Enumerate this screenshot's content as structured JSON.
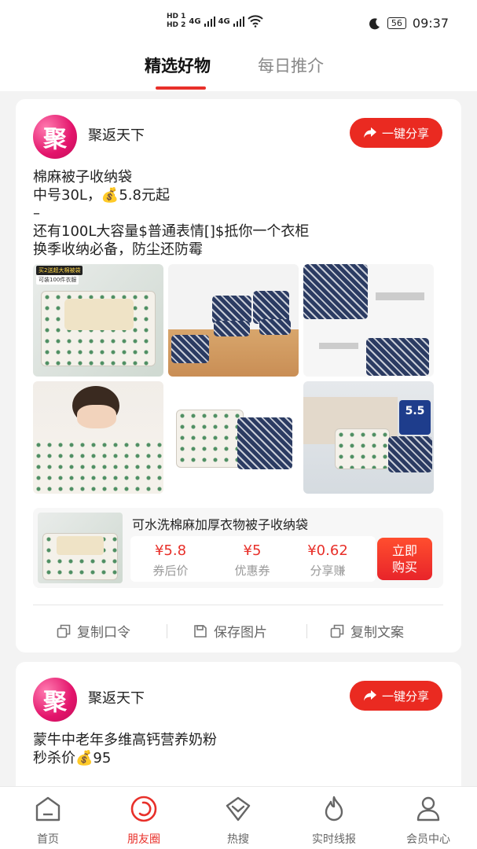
{
  "status_bar": {
    "network_1": "4G",
    "network_2": "4G",
    "battery": "56",
    "time": "09:37",
    "hd1": "HD 1",
    "hd2": "HD 2"
  },
  "top_tabs": [
    {
      "label": "精选好物",
      "active": true
    },
    {
      "label": "每日推介",
      "active": false
    }
  ],
  "post1": {
    "avatar_char": "聚",
    "user_name": "聚返天下",
    "share_label": "一键分享",
    "text_lines": [
      "棉麻被子收纳袋",
      "中号30L，💰5.8元起",
      "–",
      "还有100L大容量$普通表情[]$抵你一个衣柜",
      "换季收纳必备，防尘还防霉"
    ],
    "image_labels": {
      "tag1": "买2送超大棉被袋",
      "tag2": "可装100件衣服",
      "badge": "5.5"
    },
    "product": {
      "title": "可水洗棉麻加厚衣物被子收纳袋",
      "prices": [
        {
          "value": "¥5.8",
          "label": "券后价"
        },
        {
          "value": "¥5",
          "label": "优惠券"
        },
        {
          "value": "¥0.62",
          "label": "分享赚"
        }
      ],
      "buy_label_1": "立即",
      "buy_label_2": "购买"
    },
    "actions": [
      "复制口令",
      "保存图片",
      "复制文案"
    ]
  },
  "post2": {
    "avatar_char": "聚",
    "user_name": "聚返天下",
    "share_label": "一键分享",
    "text_lines": [
      "蒙牛中老年多维高钙营养奶粉",
      "秒杀价💰95"
    ]
  },
  "bottom_nav": [
    {
      "label": "首页",
      "icon": "home-icon",
      "active": false
    },
    {
      "label": "朋友圈",
      "icon": "moments-icon",
      "active": true
    },
    {
      "label": "热搜",
      "icon": "hot-search-icon",
      "active": false
    },
    {
      "label": "实时线报",
      "icon": "flame-icon",
      "active": false
    },
    {
      "label": "会员中心",
      "icon": "user-icon",
      "active": false
    }
  ],
  "colors": {
    "accent": "#e8302a",
    "text": "#222222",
    "muted": "#999999"
  }
}
